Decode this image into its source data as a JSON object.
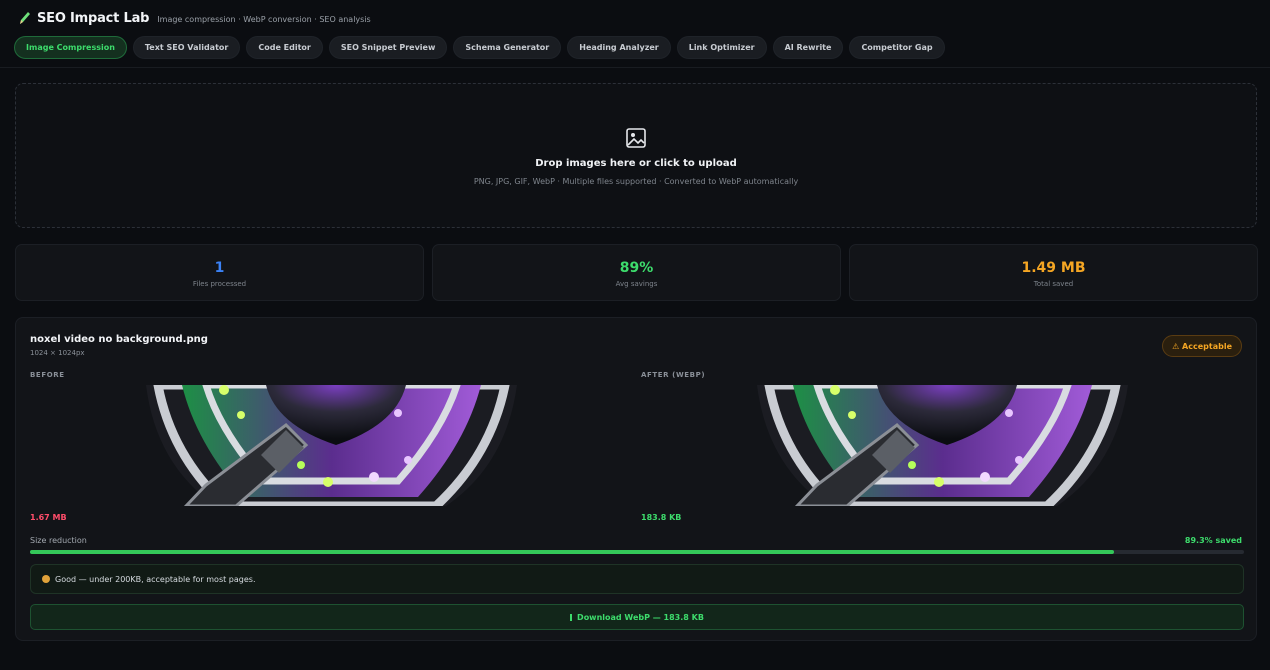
{
  "app": {
    "title": "SEO Impact Lab",
    "subtitle": "Image compression · WebP conversion · SEO analysis",
    "logo_icon": "pencil-icon"
  },
  "tabs": [
    {
      "label": "Image Compression",
      "active": true
    },
    {
      "label": "Text SEO Validator",
      "active": false
    },
    {
      "label": "Code Editor",
      "active": false
    },
    {
      "label": "SEO Snippet Preview",
      "active": false
    },
    {
      "label": "Schema Generator",
      "active": false
    },
    {
      "label": "Heading Analyzer",
      "active": false
    },
    {
      "label": "Link Optimizer",
      "active": false
    },
    {
      "label": "AI Rewrite",
      "active": false
    },
    {
      "label": "Competitor Gap",
      "active": false
    }
  ],
  "dropzone": {
    "icon": "image-upload-icon",
    "title": "Drop images here or click to upload",
    "subtitle": "PNG, JPG, GIF, WebP · Multiple files supported · Converted to WebP automatically"
  },
  "stats": [
    {
      "value": "1",
      "label": "Files processed",
      "color": "#3b82f6"
    },
    {
      "value": "89%",
      "label": "Avg savings",
      "color": "#3ddc6c"
    },
    {
      "value": "1.49 MB",
      "label": "Total saved",
      "color": "#f5a623"
    }
  ],
  "result": {
    "file_name": "noxel video no background.png",
    "dimensions": "1024 × 1024px",
    "badge": "⚠ Acceptable",
    "before_label": "BEFORE",
    "after_label": "AFTER (WEBP)",
    "before_size": "1.67 MB",
    "after_size": "183.8 KB",
    "reduction_label": "Size reduction",
    "saved_label": "89.3% saved",
    "saved_fraction": 0.893,
    "note": "Good — under 200KB, acceptable for most pages.",
    "download_label": "Download WebP — 183.8 KB"
  },
  "colors": {
    "accent_green": "#3ddc6c",
    "warn_orange": "#f5a623",
    "error_red": "#ff4d6a",
    "info_blue": "#3b82f6"
  }
}
